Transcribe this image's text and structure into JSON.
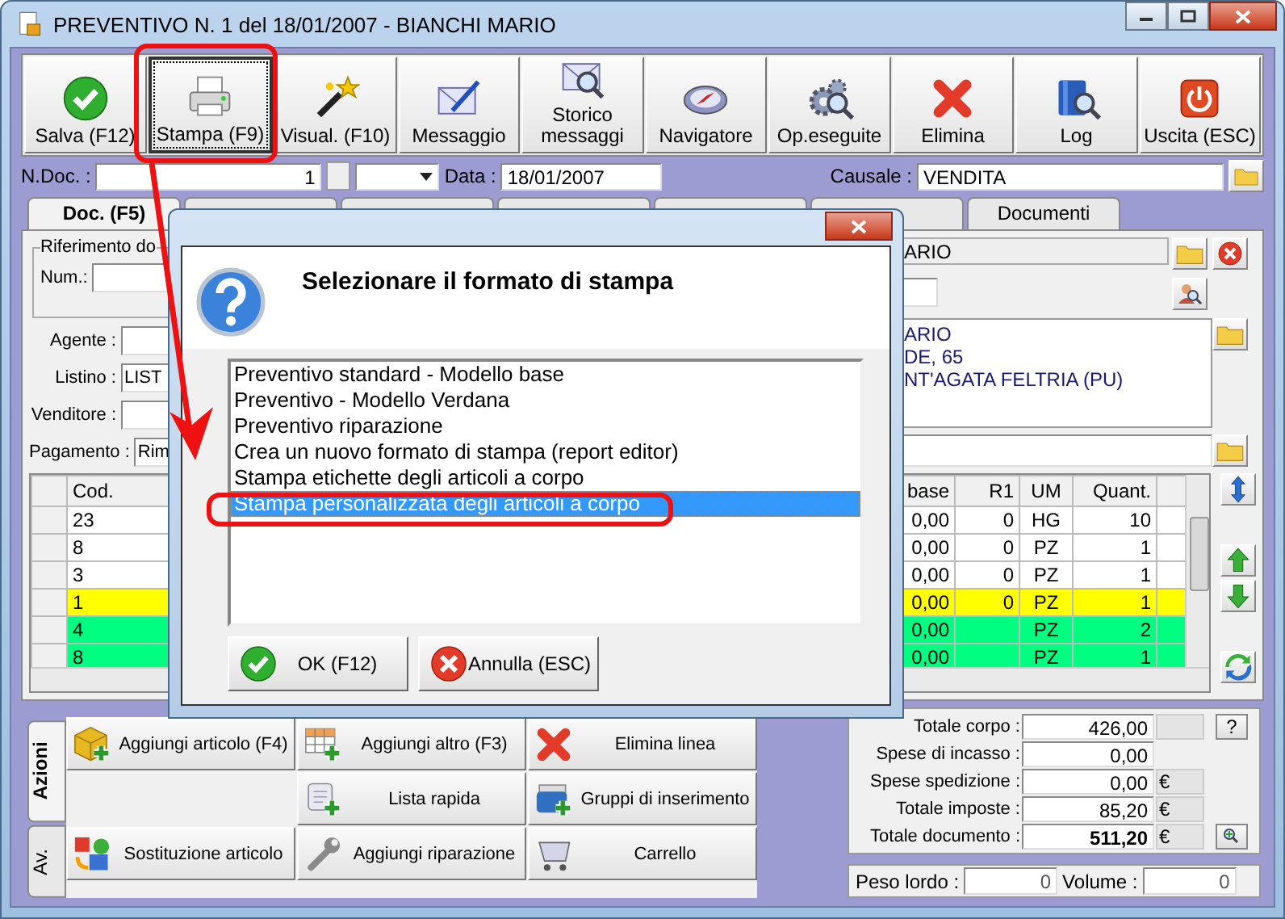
{
  "window": {
    "title": "PREVENTIVO N. 1  del 18/01/2007 - BIANCHI MARIO"
  },
  "toolbar": [
    {
      "label": "Salva (F12)",
      "kind": "check",
      "focused": false
    },
    {
      "label": "Stampa (F9)",
      "kind": "printer",
      "focused": true
    },
    {
      "label": "Visual. (F10)",
      "kind": "wand",
      "focused": false
    },
    {
      "label": "Messaggio",
      "kind": "envelope-pen",
      "focused": false
    },
    {
      "label": "Storico\nmessaggi",
      "kind": "envelope-magnifier",
      "focused": false
    },
    {
      "label": "Navigatore",
      "kind": "compass",
      "focused": false
    },
    {
      "label": "Op.eseguite",
      "kind": "gears",
      "focused": false
    },
    {
      "label": "Elimina",
      "kind": "cross",
      "focused": false
    },
    {
      "label": "Log",
      "kind": "book-magnifier",
      "focused": false
    },
    {
      "label": "Uscita (ESC)",
      "kind": "power",
      "focused": false
    }
  ],
  "header": {
    "ndoc_label": "N.Doc. :",
    "ndoc": "1",
    "data_label": "Data :",
    "data": "18/01/2007",
    "causale_label": "Causale :",
    "causale": "VENDITA"
  },
  "tabs": [
    {
      "label": "Doc. (F5)",
      "selected": true
    },
    {
      "selected": false
    },
    {
      "selected": false
    },
    {
      "selected": false
    },
    {
      "selected": false
    },
    {
      "selected": false
    },
    {
      "label": "Documenti",
      "selected": false
    }
  ],
  "reference": {
    "legend": "Riferimento do",
    "num_label": "Num.:"
  },
  "fields": [
    {
      "label": "Agente :"
    },
    {
      "label": "Listino :",
      "value": "LIST"
    },
    {
      "label": "Venditore :"
    },
    {
      "label": "Pagamento :",
      "value": "Rim"
    }
  ],
  "customer": {
    "name": "ARIO",
    "address": [
      "ARIO",
      "DE, 65",
      "NT'AGATA FELTRIA (PU)"
    ]
  },
  "grid": {
    "columns": [
      "Cod.",
      "base",
      "R1",
      "UM",
      "Quant."
    ],
    "rows": [
      {
        "cells": [
          "23",
          "0,00",
          "0",
          "HG",
          "10"
        ],
        "color": "#ffffff"
      },
      {
        "cells": [
          "8",
          "0,00",
          "0",
          "PZ",
          "1"
        ],
        "color": "#ffffff"
      },
      {
        "cells": [
          "3",
          "0,00",
          "0",
          "PZ",
          "1"
        ],
        "color": "#ffffff"
      },
      {
        "cells": [
          "1",
          "0,00",
          "0",
          "PZ",
          "1"
        ],
        "color": "#ffff00"
      },
      {
        "cells": [
          "4",
          "0,00",
          "",
          "PZ",
          "2"
        ],
        "color": "#00ff80"
      },
      {
        "cells": [
          "8",
          "0,00",
          "",
          "PZ",
          "1"
        ],
        "color": "#00ff80"
      }
    ]
  },
  "side_tabs": [
    {
      "label": "Azioni",
      "selected": true
    },
    {
      "label": "Av.",
      "selected": false
    }
  ],
  "actions": [
    {
      "label": "Aggiungi articolo (F4)",
      "kind": "box-plus"
    },
    {
      "label": "Aggiungi altro (F3)",
      "kind": "grid-plus"
    },
    {
      "label": "Elimina linea",
      "kind": "cross"
    },
    {
      "kind": "blank"
    },
    {
      "label": "Lista rapida",
      "kind": "scroll-plus"
    },
    {
      "label": "Gruppi di inserimento",
      "kind": "basket-plus"
    },
    {
      "label": "Sostituzione articolo",
      "kind": "swap"
    },
    {
      "label": "Aggiungi riparazione",
      "kind": "wrench"
    },
    {
      "label": "Carrello",
      "kind": "cart"
    }
  ],
  "totals": [
    {
      "label": "Totale corpo :",
      "value": "426,00",
      "kind": "help",
      "button": "?"
    },
    {
      "label": "Spese di incasso :",
      "value": "0,00",
      "kind": "plain"
    },
    {
      "label": "Spese spedizione :",
      "value": "0,00",
      "unit": "€",
      "kind": "plain"
    },
    {
      "label": "Totale imposte :",
      "value": "85,20",
      "unit": "€",
      "kind": "plain"
    },
    {
      "label": "Totale documento :",
      "value": "511,20",
      "unit": "€",
      "kind": "zoom"
    }
  ],
  "weights": [
    {
      "label": "Peso lordo :",
      "value": "0"
    },
    {
      "label": "Volume :",
      "value": "0"
    }
  ],
  "dialog": {
    "title": "Selezionare il formato di stampa",
    "items": [
      {
        "label": "Preventivo standard - Modello base",
        "selected": false
      },
      {
        "label": "Preventivo - Modello Verdana",
        "selected": false
      },
      {
        "label": "Preventivo riparazione",
        "selected": false
      },
      {
        "label": "Crea un nuovo formato di stampa (report editor)",
        "selected": false
      },
      {
        "label": "Stampa etichette degli articoli a corpo",
        "selected": false
      },
      {
        "label": "Stampa personalizzata degli articoli a corpo",
        "selected": true
      }
    ],
    "buttons": [
      {
        "label": "OK (F12)",
        "kind": "check"
      },
      {
        "label": "Annulla (ESC)",
        "kind": "x-circle"
      }
    ]
  }
}
